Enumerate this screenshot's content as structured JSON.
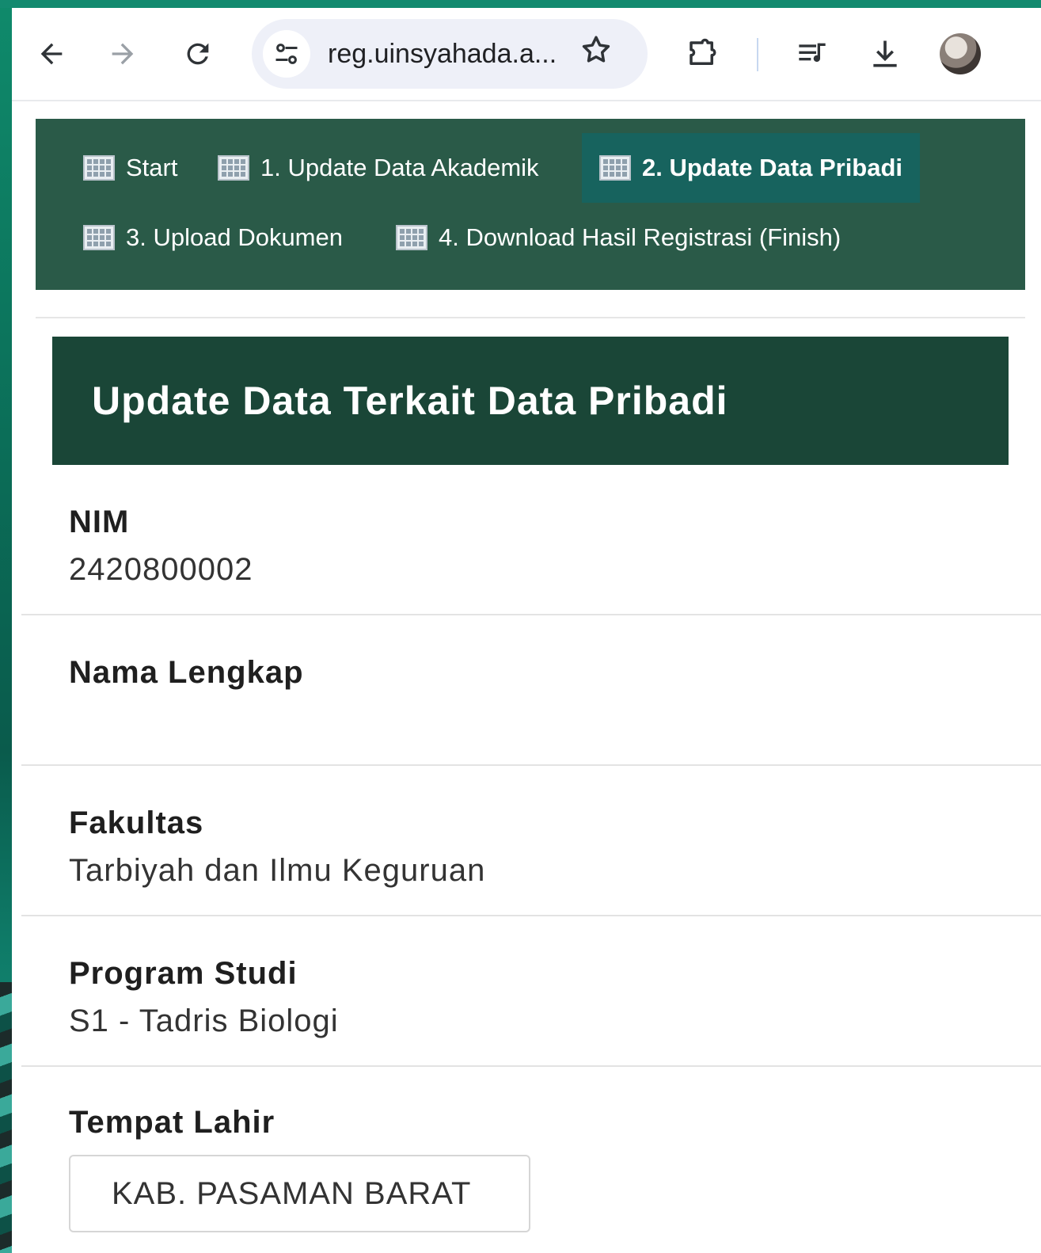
{
  "browser": {
    "url": "reg.uinsyahada.a..."
  },
  "steps": [
    {
      "label": "Start",
      "active": false
    },
    {
      "label": "1. Update Data Akademik",
      "active": false
    },
    {
      "label": "2. Update Data Pribadi",
      "active": true
    },
    {
      "label": "3. Upload Dokumen",
      "active": false
    },
    {
      "label": "4. Download Hasil Registrasi (Finish)",
      "active": false
    }
  ],
  "section": {
    "title": "Update Data Terkait Data Pribadi"
  },
  "fields": {
    "nim": {
      "label": "NIM",
      "value": "2420800002"
    },
    "nama_lengkap": {
      "label": "Nama Lengkap",
      "value": ""
    },
    "fakultas": {
      "label": "Fakultas",
      "value": "Tarbiyah dan Ilmu Keguruan"
    },
    "program_studi": {
      "label": "Program Studi",
      "value": "S1 - Tadris Biologi"
    },
    "tempat_lahir": {
      "label": "Tempat Lahir",
      "value": "KAB. PASAMAN BARAT"
    }
  },
  "icons": {
    "back": "arrow-left-icon",
    "forward": "arrow-right-icon",
    "reload": "reload-icon",
    "site_info": "tune-icon",
    "bookmark": "star-icon",
    "extensions": "puzzle-icon",
    "media": "media-queue-icon",
    "downloads": "download-icon",
    "step": "table-icon"
  },
  "colors": {
    "nav_bg": "#2a5a48",
    "nav_active": "#17635e",
    "header_bg": "#1a4637"
  }
}
